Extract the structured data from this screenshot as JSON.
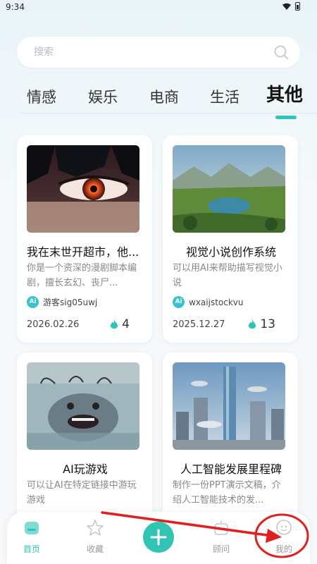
{
  "status_bar": {
    "time": "9:34"
  },
  "search": {
    "placeholder": "搜索"
  },
  "tabs": [
    {
      "label": "情感"
    },
    {
      "label": "娱乐"
    },
    {
      "label": "电商"
    },
    {
      "label": "生活"
    },
    {
      "label": "其他",
      "active": true
    }
  ],
  "cards": [
    {
      "title": "我在末世开超市，他...",
      "desc": "你是一个资深的漫剧脚本编剧，擅长玄幻、丧尸...",
      "author": "游客sig05uwj",
      "date": "2026.02.26",
      "hot": "4"
    },
    {
      "title": "视觉小说创作系统",
      "desc": "可以用AI来帮助描写视觉小说",
      "author": "wxaijstockvu",
      "date": "2025.12.27",
      "hot": "13"
    },
    {
      "title": "AI玩游戏",
      "desc": "可以让AI在特定链接中游玩游戏"
    },
    {
      "title": "人工智能发展里程碑",
      "desc": "制作一份PPT演示文稿，介绍人工智能技术的发..."
    }
  ],
  "ai_badge": "Ai",
  "bottom_nav": [
    {
      "label": "首页",
      "icon": "home-icon",
      "active": true
    },
    {
      "label": "收藏",
      "icon": "star-icon"
    },
    {
      "label": "",
      "icon": "plus-icon"
    },
    {
      "label": "顾问",
      "icon": "robot-icon"
    },
    {
      "label": "我的",
      "icon": "profile-icon"
    }
  ],
  "colors": {
    "accent": "#2ec4b6",
    "annotation": "#e02020",
    "flame": "#2ec4b6"
  }
}
